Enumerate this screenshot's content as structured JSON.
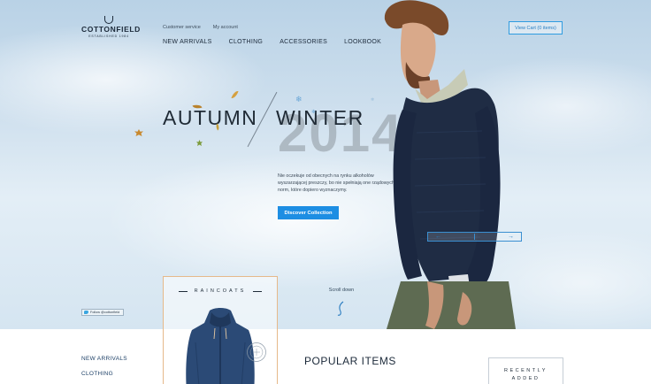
{
  "brand": {
    "name": "COTTONFIELD",
    "tagline": "ESTABLISHED 1984"
  },
  "utility_nav": [
    "Customer service",
    "My account"
  ],
  "main_nav": [
    "NEW ARRIVALS",
    "CLOTHING",
    "ACCESSORIES",
    "LOOKBOOK"
  ],
  "cart": {
    "label": "View Cart (0 items)"
  },
  "hero": {
    "season_left": "AUTUMN",
    "season_right": "WINTER",
    "year": "2014",
    "description": "Nie oczekuje od obecnych na rynku alkoholów wyszarzającej preszczy, bo nie spełniają one rządowych norm, które dopiero wyznaczymy.",
    "cta_label": "Discover Collection",
    "scroll_label": "Scroll down"
  },
  "twitter": {
    "label": "Follow @cottonfield"
  },
  "feature_card": {
    "title": "RAINCOATS"
  },
  "side_menu": [
    "NEW ARRIVALS",
    "CLOTHING"
  ],
  "popular": {
    "title": "POPULAR ITEMS"
  },
  "recently_added": {
    "line1": "RECENTLY",
    "line2": "ADDED"
  },
  "colors": {
    "accent": "#1d8ee3",
    "card_border": "#e6b98a",
    "navy": "#1c2a3a"
  },
  "icons": [
    "crest-icon",
    "snowflake-icon",
    "leaf-icon",
    "arrow-left-icon",
    "arrow-right-icon",
    "scroll-hook-icon",
    "twitter-bird-icon",
    "stamp-icon"
  ]
}
